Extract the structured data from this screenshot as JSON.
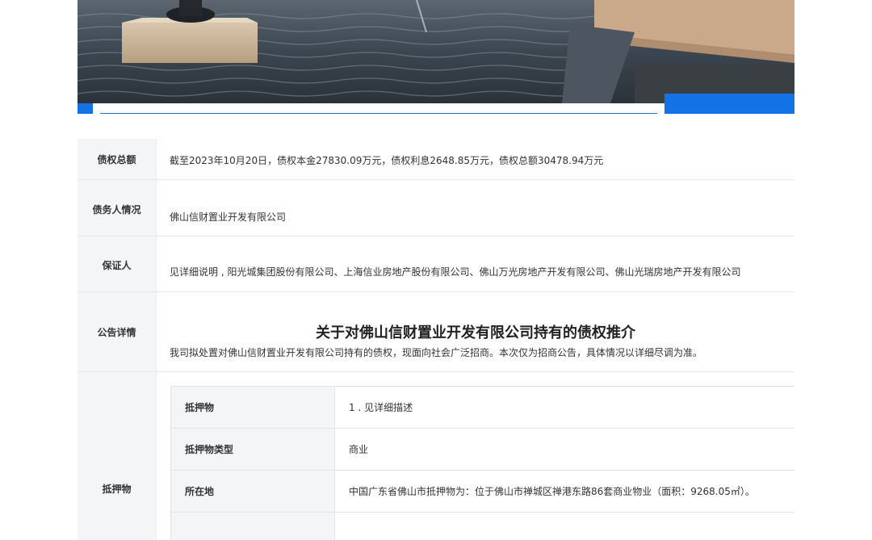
{
  "banner": {
    "image_desc": "fountain-pool-photo"
  },
  "rows": {
    "debt_total": {
      "label": "债权总额",
      "value": "截至2023年10月20日，债权本金27830.09万元，债权利息2648.85万元，债权总额30478.94万元"
    },
    "debtor": {
      "label": "债务人情况",
      "value": "佛山信财置业开发有限公司"
    },
    "guarantor": {
      "label": "保证人",
      "value": "见详细说明 , 阳光城集团股份有限公司、上海信业房地产股份有限公司、佛山万光房地产开发有限公司、佛山光瑞房地产开发有限公司"
    },
    "notice": {
      "label": "公告详情",
      "title": "关于对佛山信财置业开发有限公司持有的债权推介",
      "body": "我司拟处置对佛山信财置业开发有限公司持有的债权，现面向社会广泛招商。本次仅为招商公告，具体情况以详细尽调为准。"
    },
    "collateral": {
      "label": "抵押物",
      "items": [
        {
          "label": "抵押物",
          "value": "1 . 见详细描述"
        },
        {
          "label": "抵押物类型",
          "value": "商业"
        },
        {
          "label": "所在地",
          "value": "中国广东省佛山市抵押物为：位于佛山市禅城区禅港东路86套商业物业（面积：9268.05㎡）。"
        },
        {
          "label": "",
          "value": ""
        }
      ]
    }
  },
  "colors": {
    "accent_blue": "#1373e6",
    "label_bg": "#f4f5f7",
    "border": "#e8e8e8"
  }
}
